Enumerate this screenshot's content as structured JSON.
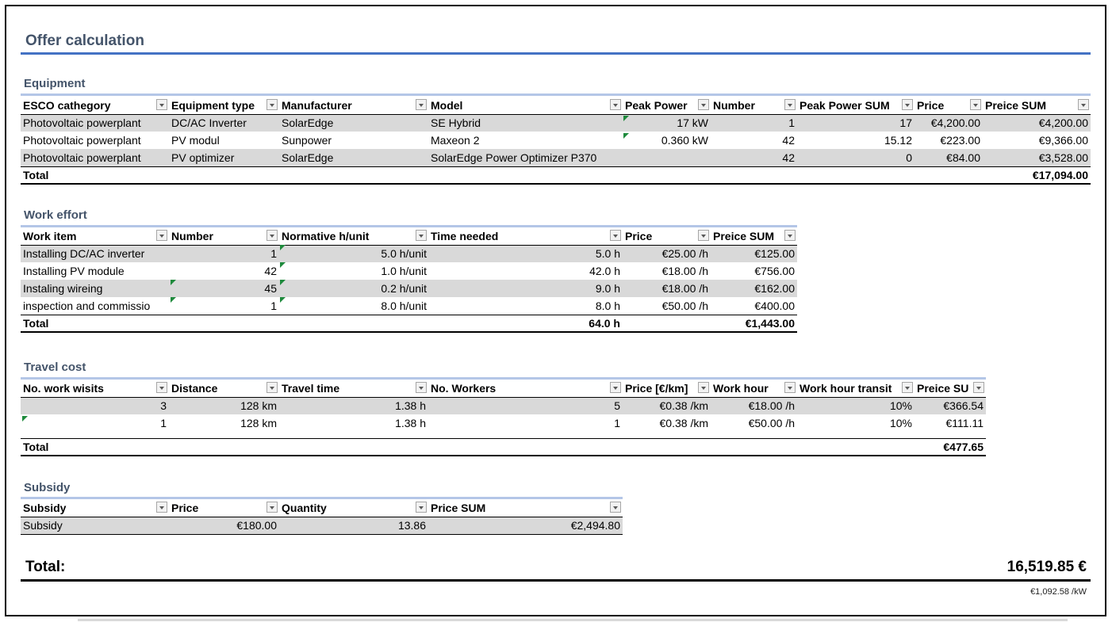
{
  "title": "Offer calculation",
  "equipment": {
    "title": "Equipment",
    "headers": [
      "ESCO cathegory",
      "Equipment type",
      "Manufacturer",
      "Model",
      "Peak Power",
      "Number",
      "Peak Power SUM",
      "Price",
      "Preice SUM"
    ],
    "rows": [
      [
        "Photovoltaic powerplant",
        "DC/AC Inverter",
        "SolarEdge",
        "SE Hybrid",
        "17 kW",
        "1",
        "17",
        "€4,200.00",
        "€4,200.00"
      ],
      [
        "Photovoltaic powerplant",
        "PV modul",
        "Sunpower",
        "Maxeon 2",
        "0.360 kW",
        "42",
        "15.12",
        "€223.00",
        "€9,366.00"
      ],
      [
        "Photovoltaic powerplant",
        "PV optimizer",
        "SolarEdge",
        "SolarEdge Power Optimizer P370",
        "",
        "42",
        "0",
        "€84.00",
        "€3,528.00"
      ]
    ],
    "total_label": "Total",
    "total_value": "€17,094.00"
  },
  "work": {
    "title": "Work effort",
    "headers": [
      "Work item",
      "Number",
      "Normative h/unit",
      "Time needed",
      "Price",
      "Preice SUM"
    ],
    "rows": [
      [
        "Installing DC/AC inverter",
        "1",
        "5.0 h/unit",
        "5.0 h",
        "€25.00 /h",
        "€125.00"
      ],
      [
        "Installing PV module",
        "42",
        "1.0 h/unit",
        "42.0 h",
        "€18.00 /h",
        "€756.00"
      ],
      [
        "Instaling wireing",
        "45",
        "0.2 h/unit",
        "9.0 h",
        "€18.00 /h",
        "€162.00"
      ],
      [
        "inspection and commissio",
        "1",
        "8.0 h/unit",
        "8.0 h",
        "€50.00 /h",
        "€400.00"
      ]
    ],
    "total_label": "Total",
    "total_time": "64.0 h",
    "total_value": "€1,443.00"
  },
  "travel": {
    "title": "Travel cost",
    "headers": [
      "No. work wisits",
      "Distance",
      "Travel time",
      "No. Workers",
      "Price [€/km]",
      "Work hour",
      "Work hour transit",
      "Preice SU"
    ],
    "rows": [
      [
        "3",
        "128 km",
        "1.38 h",
        "5",
        "€0.38 /km",
        "€18.00 /h",
        "10%",
        "€366.54"
      ],
      [
        "1",
        "128 km",
        "1.38 h",
        "1",
        "€0.38 /km",
        "€50.00 /h",
        "10%",
        "€111.11"
      ]
    ],
    "total_label": "Total",
    "total_value": "€477.65"
  },
  "subsidy": {
    "title": "Subsidy",
    "headers": [
      "Subsidy",
      "Price",
      "Quantity",
      "Price SUM"
    ],
    "rows": [
      [
        "Subsidy",
        "€180.00",
        "13.86",
        "€2,494.80"
      ]
    ]
  },
  "grand_total_label": "Total:",
  "grand_total_value": "16,519.85 €",
  "per_kw": "€1,092.58 /kW"
}
